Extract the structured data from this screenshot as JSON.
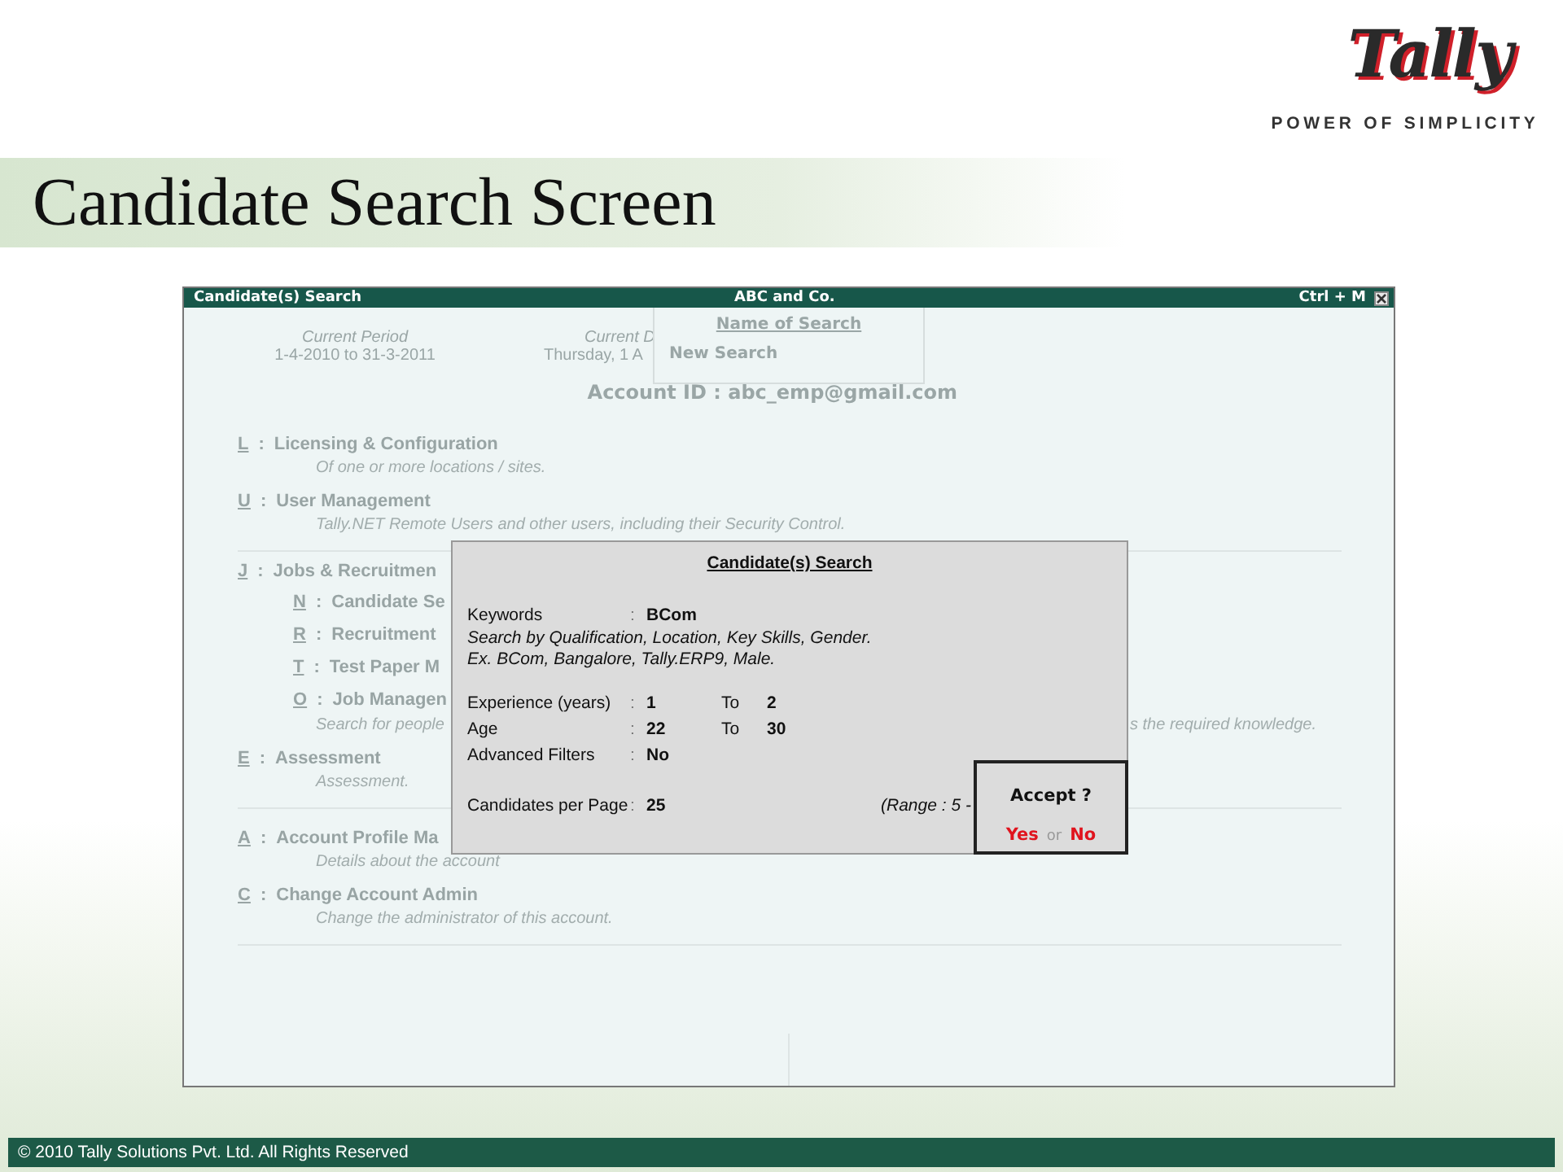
{
  "logo": {
    "wordmark": "Tally",
    "tagline": "POWER OF SIMPLICITY"
  },
  "slide_title": "Candidate Search Screen",
  "window": {
    "title": "Candidate(s) Search",
    "company": "ABC and Co.",
    "shortcut": "Ctrl + M"
  },
  "period": {
    "label": "Current Period",
    "value": "1-4-2010 to 31-3-2011"
  },
  "date": {
    "label": "Current D",
    "value": "Thursday, 1 A"
  },
  "name_popup": {
    "title": "Name of Search",
    "items": [
      "New Search"
    ]
  },
  "account_id": "Account ID : abc_emp@gmail.com",
  "menu_groups": [
    [
      {
        "key": "L",
        "colon": ":",
        "label": "Licensing & Configuration",
        "description": "Of one or more locations / sites."
      },
      {
        "key": "U",
        "colon": ":",
        "label": "User Management",
        "description": "Tally.NET Remote Users and other users, including their Security Control."
      }
    ],
    [
      {
        "key": "J",
        "colon": ":",
        "label": "Jobs & Recruitmen",
        "children": [
          {
            "key": "N",
            "colon": ":",
            "label": "Candidate Se"
          },
          {
            "key": "R",
            "colon": ":",
            "label": "Recruitment"
          },
          {
            "key": "T",
            "colon": ":",
            "label": "Test Paper M"
          },
          {
            "key": "O",
            "colon": ":",
            "label": "Job Managen",
            "description": "Search for people",
            "description_right": "s the required knowledge."
          }
        ]
      },
      {
        "key": "E",
        "colon": ":",
        "label": "Assessment",
        "description": "Assessment."
      }
    ],
    [
      {
        "key": "A",
        "colon": ":",
        "label": "Account Profile Ma",
        "description": "Details about the account"
      },
      {
        "key": "C",
        "colon": ":",
        "label": "Change Account Admin",
        "description": "Change the administrator of this account."
      }
    ]
  ],
  "dialog": {
    "title": "Candidate(s) Search",
    "keywords": {
      "label": "Keywords",
      "colon": ":",
      "value": "BCom"
    },
    "hints": [
      "Search by Qualification, Location, Key Skills, Gender.",
      "Ex. BCom, Bangalore, Tally.ERP9, Male."
    ],
    "filters": [
      {
        "label": "Experience (years)",
        "colon": ":",
        "value": "1",
        "to_label": "To",
        "value_to": "2"
      },
      {
        "label": "Age",
        "colon": ":",
        "value": "22",
        "to_label": "To",
        "value_to": "30"
      },
      {
        "label": "Advanced Filters",
        "colon": ":",
        "value": "No"
      }
    ],
    "per_page": {
      "label": "Candidates per Page",
      "colon": ":",
      "value": "25",
      "range": "(Range : 5 -"
    }
  },
  "accept": {
    "question": "Accept ?",
    "yes": "Yes",
    "or": "or",
    "no": "No"
  },
  "footer": "© 2010 Tally Solutions Pvt. Ltd. All Rights Reserved"
}
